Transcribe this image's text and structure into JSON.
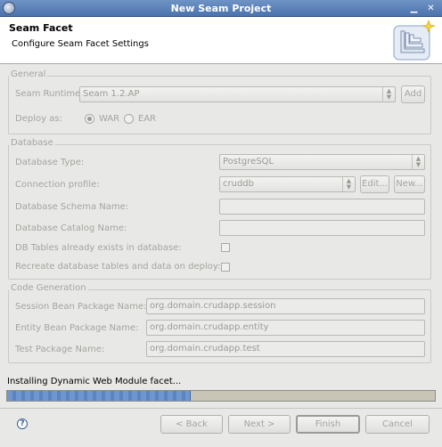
{
  "window": {
    "title": "New Seam Project"
  },
  "header": {
    "title": "Seam Facet",
    "subtitle": "Configure Seam Facet Settings"
  },
  "general": {
    "legend": "General",
    "runtime_label": "Seam Runtime",
    "runtime_value": "Seam 1.2.AP",
    "add_label": "Add",
    "deploy_label": "Deploy as:",
    "war_label": "WAR",
    "ear_label": "EAR"
  },
  "database": {
    "legend": "Database",
    "type_label": "Database Type:",
    "type_value": "PostgreSQL",
    "profile_label": "Connection profile:",
    "profile_value": "cruddb",
    "edit_label": "Edit...",
    "new_label": "New...",
    "schema_label": "Database Schema Name:",
    "schema_value": "",
    "catalog_label": "Database Catalog Name:",
    "catalog_value": "",
    "tables_exist_label": "DB Tables already exists in database:",
    "recreate_label": "Recreate database tables and data on deploy:"
  },
  "codegen": {
    "legend": "Code Generation",
    "session_label": "Session Bean Package Name:",
    "session_value": "org.domain.crudapp.session",
    "entity_label": "Entity Bean Package Name:",
    "entity_value": "org.domain.crudapp.entity",
    "test_label": "Test Package Name:",
    "test_value": "org.domain.crudapp.test"
  },
  "status": {
    "text": "Installing Dynamic Web Module facet...",
    "progress": 0.43
  },
  "footer": {
    "back_label": "< Back",
    "next_label": "Next >",
    "finish_label": "Finish",
    "cancel_label": "Cancel",
    "help_glyph": "?"
  },
  "colors": {
    "title_bar": "#4a73ad",
    "progress_fill": "#6f96cf",
    "disabled_text": "#a4a49e"
  }
}
